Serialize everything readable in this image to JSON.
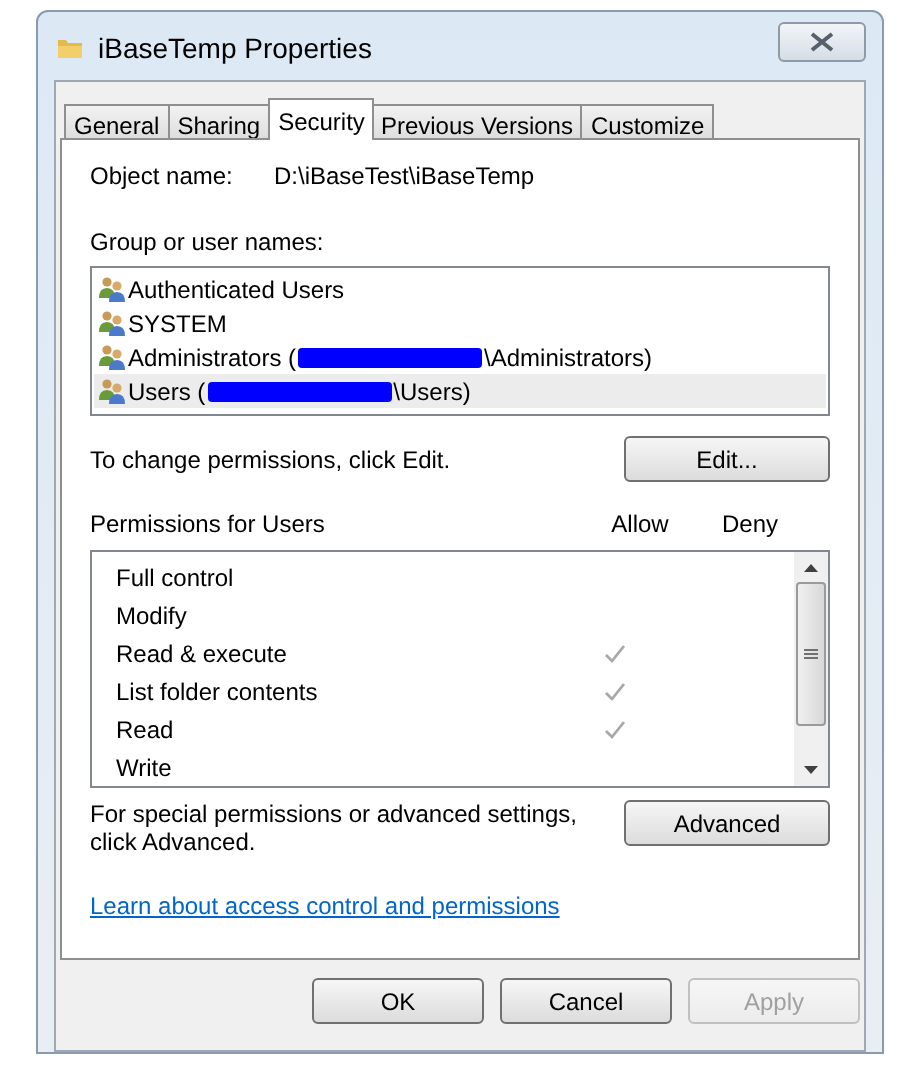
{
  "window": {
    "title": "iBaseTemp Properties"
  },
  "tabs": [
    {
      "label": "General",
      "selected": false
    },
    {
      "label": "Sharing",
      "selected": false
    },
    {
      "label": "Security",
      "selected": true
    },
    {
      "label": "Previous Versions",
      "selected": false
    },
    {
      "label": "Customize",
      "selected": false
    }
  ],
  "object_name": {
    "label": "Object name:",
    "value": "D:\\iBaseTest\\iBaseTemp"
  },
  "groups": {
    "label": "Group or user names:",
    "items": [
      {
        "name": "Authenticated Users",
        "selected": false
      },
      {
        "name": "SYSTEM",
        "selected": false
      },
      {
        "name": "Administrators (",
        "suffix": "\\Administrators)",
        "redacted": true,
        "selected": false
      },
      {
        "name": "Users (",
        "suffix": "\\Users)",
        "redacted": true,
        "selected": true
      }
    ]
  },
  "edit_hint": "To change permissions, click Edit.",
  "edit_button": "Edit...",
  "permissions": {
    "label": "Permissions for Users",
    "allow_header": "Allow",
    "deny_header": "Deny",
    "items": [
      {
        "name": "Full control",
        "allow": false,
        "deny": false
      },
      {
        "name": "Modify",
        "allow": false,
        "deny": false
      },
      {
        "name": "Read & execute",
        "allow": true,
        "deny": false
      },
      {
        "name": "List folder contents",
        "allow": true,
        "deny": false
      },
      {
        "name": "Read",
        "allow": true,
        "deny": false
      },
      {
        "name": "Write",
        "allow": false,
        "deny": false
      }
    ]
  },
  "advanced_hint": "For special permissions or advanced settings, click Advanced.",
  "advanced_button": "Advanced",
  "link": "Learn about access control and permissions",
  "buttons": [
    {
      "label": "OK",
      "disabled": false
    },
    {
      "label": "Cancel",
      "disabled": false
    },
    {
      "label": "Apply",
      "disabled": true
    }
  ]
}
